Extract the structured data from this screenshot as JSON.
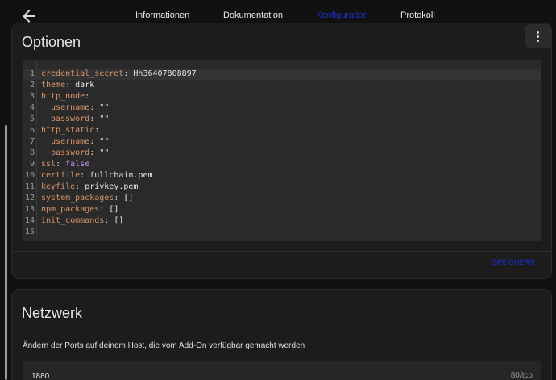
{
  "header": {
    "back_icon": "arrow-left-icon",
    "tabs": [
      {
        "label": "Informationen",
        "active": false
      },
      {
        "label": "Dokumentation",
        "active": false
      },
      {
        "label": "Konfiguration",
        "active": true
      },
      {
        "label": "Protokoll",
        "active": false
      }
    ]
  },
  "colors": {
    "accent": "#1a2fd0",
    "background": "#111111",
    "card": "#1c1c1c",
    "editor": "#2a2a2a",
    "yaml_key": "#d9966a",
    "yaml_keyword": "#b897e6"
  },
  "options_card": {
    "title": "Optionen",
    "menu_icon": "more-vertical-icon",
    "save_label": "SPEICHERN",
    "editor_lines": [
      {
        "num": "1",
        "key": "credential_secret",
        "sep": ": ",
        "value": "Hh36407808897",
        "kind": "str"
      },
      {
        "num": "2",
        "key": "theme",
        "sep": ": ",
        "value": "dark",
        "kind": "str"
      },
      {
        "num": "3",
        "key": "http_node",
        "sep": ":",
        "value": "",
        "kind": "str"
      },
      {
        "num": "4",
        "key": "  username",
        "sep": ": ",
        "value": "\"\"",
        "kind": "str"
      },
      {
        "num": "5",
        "key": "  password",
        "sep": ": ",
        "value": "\"\"",
        "kind": "str"
      },
      {
        "num": "6",
        "key": "http_static",
        "sep": ":",
        "value": "",
        "kind": "str"
      },
      {
        "num": "7",
        "key": "  username",
        "sep": ": ",
        "value": "\"\"",
        "kind": "str"
      },
      {
        "num": "8",
        "key": "  password",
        "sep": ": ",
        "value": "\"\"",
        "kind": "str"
      },
      {
        "num": "9",
        "key": "ssl",
        "sep": ": ",
        "value": "false",
        "kind": "kw"
      },
      {
        "num": "10",
        "key": "certfile",
        "sep": ": ",
        "value": "fullchain.pem",
        "kind": "str"
      },
      {
        "num": "11",
        "key": "keyfile",
        "sep": ": ",
        "value": "privkey.pem",
        "kind": "str"
      },
      {
        "num": "12",
        "key": "system_packages",
        "sep": ": ",
        "value": "[]",
        "kind": "str"
      },
      {
        "num": "13",
        "key": "npm_packages",
        "sep": ": ",
        "value": "[]",
        "kind": "str"
      },
      {
        "num": "14",
        "key": "init_commands",
        "sep": ": ",
        "value": "[]",
        "kind": "str"
      },
      {
        "num": "15",
        "key": "",
        "sep": "",
        "value": "",
        "kind": "str"
      }
    ]
  },
  "network_card": {
    "title": "Netzwerk",
    "description": "Ändern der Ports auf deinem Host, die vom Add-On verfügbar gemacht werden",
    "port_value": "1880",
    "port_suffix": "80/tcp"
  }
}
